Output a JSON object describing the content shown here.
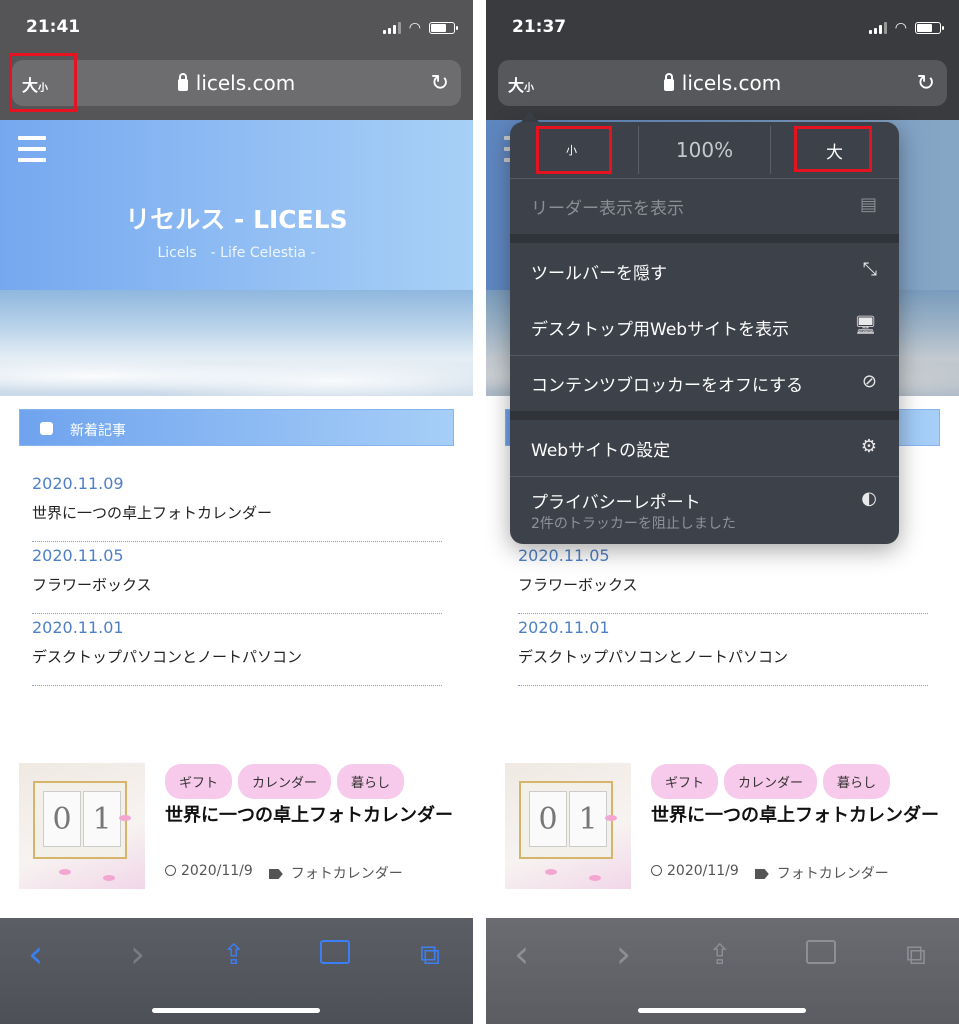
{
  "left": {
    "status_time": "21:41",
    "url_button_large": "大",
    "url_button_small": "小",
    "url": "licels.com",
    "site_title": "リセルス - LICELS",
    "site_subtitle": "Licels　- Life Celestia -",
    "news_header": "新着記事",
    "news": [
      {
        "date": "2020.11.09",
        "title": "世界に一つの卓上フォトカレンダー"
      },
      {
        "date": "2020.11.05",
        "title": "フラワーボックス"
      },
      {
        "date": "2020.11.01",
        "title": "デスクトップパソコンとノートパソコン"
      }
    ],
    "card": {
      "tags": [
        "ギフト",
        "カレンダー",
        "暮らし"
      ],
      "title": "世界に一つの卓上フォトカレンダー",
      "date": "2020/11/9",
      "category": "フォトカレンダー",
      "thumb_digits": [
        "0",
        "1"
      ]
    }
  },
  "right": {
    "status_time": "21:37",
    "url_button_large": "大",
    "url_button_small": "小",
    "url": "licels.com",
    "zoom_small": "小",
    "zoom_percent": "100%",
    "zoom_large": "大",
    "menu": {
      "reader": "リーダー表示を表示",
      "hide_toolbar": "ツールバーを隠す",
      "desktop_site": "デスクトップ用Webサイトを表示",
      "content_blockers": "コンテンツブロッカーをオフにする",
      "website_settings": "Webサイトの設定",
      "privacy_report": "プライバシーレポート",
      "privacy_sub": "2件のトラッカーを阻止しました"
    },
    "news": [
      {
        "date": "2020.11.05",
        "title": "フラワーボックス"
      },
      {
        "date": "2020.11.01",
        "title": "デスクトップパソコンとノートパソコン"
      }
    ],
    "card": {
      "tags": [
        "ギフト",
        "カレンダー",
        "暮らし"
      ],
      "title": "世界に一つの卓上フォトカレンダー",
      "date": "2020/11/9",
      "category": "フォトカレンダー",
      "thumb_digits": [
        "0",
        "1"
      ]
    }
  },
  "icons": {
    "back": "‹",
    "forward": "›",
    "share": "⇪",
    "bookmarks": "📖",
    "tabs": "⧉",
    "reload": "↻",
    "reader_icon": "▤",
    "expand_icon": "⤡",
    "desktop_icon": "🖥",
    "blocker_icon": "⊘",
    "settings_icon": "⚙",
    "privacy_icon": "◐"
  },
  "colors": {
    "highlight": "#e5121f",
    "link_blue": "#4f80c6",
    "tag_pink": "#f7c9ea",
    "toolbar_blue": "#3b7ff5"
  }
}
